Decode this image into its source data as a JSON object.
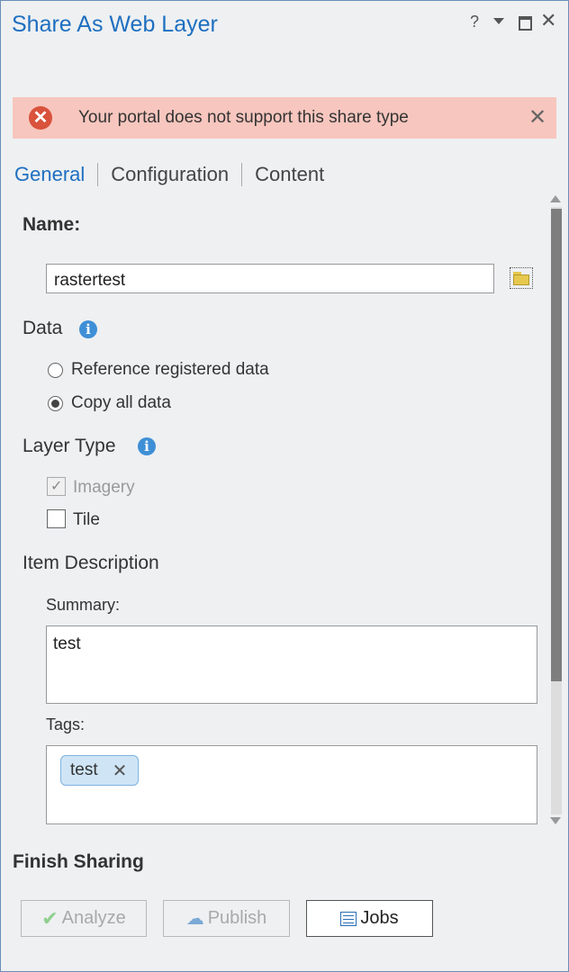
{
  "window": {
    "title": "Share As Web Layer",
    "controls": {
      "help": "?",
      "close": "✕"
    }
  },
  "error": {
    "message": "Your portal does not support this share type",
    "icon": "error-x-icon",
    "close": "✕",
    "color": "#f7c6be"
  },
  "tabs": [
    {
      "label": "General",
      "active": true
    },
    {
      "label": "Configuration",
      "active": false
    },
    {
      "label": "Content",
      "active": false
    }
  ],
  "general": {
    "name_label": "Name:",
    "name_value": "rastertest",
    "data": {
      "label": "Data",
      "options": [
        {
          "label": "Reference registered data",
          "selected": false
        },
        {
          "label": "Copy all data",
          "selected": true
        }
      ]
    },
    "layer_type": {
      "label": "Layer Type",
      "options": [
        {
          "label": "Imagery",
          "checked": true,
          "disabled": true
        },
        {
          "label": "Tile",
          "checked": false,
          "disabled": false
        }
      ]
    },
    "item_description": {
      "label": "Item Description",
      "summary_label": "Summary:",
      "summary_value": "test",
      "tags_label": "Tags:",
      "tags": [
        "test"
      ]
    }
  },
  "finish": {
    "label": "Finish Sharing",
    "buttons": {
      "analyze": "Analyze",
      "publish": "Publish",
      "jobs": "Jobs"
    }
  },
  "colors": {
    "accent": "#1e6fc0",
    "info": "#3f8fd6",
    "error": "#d9523c"
  }
}
